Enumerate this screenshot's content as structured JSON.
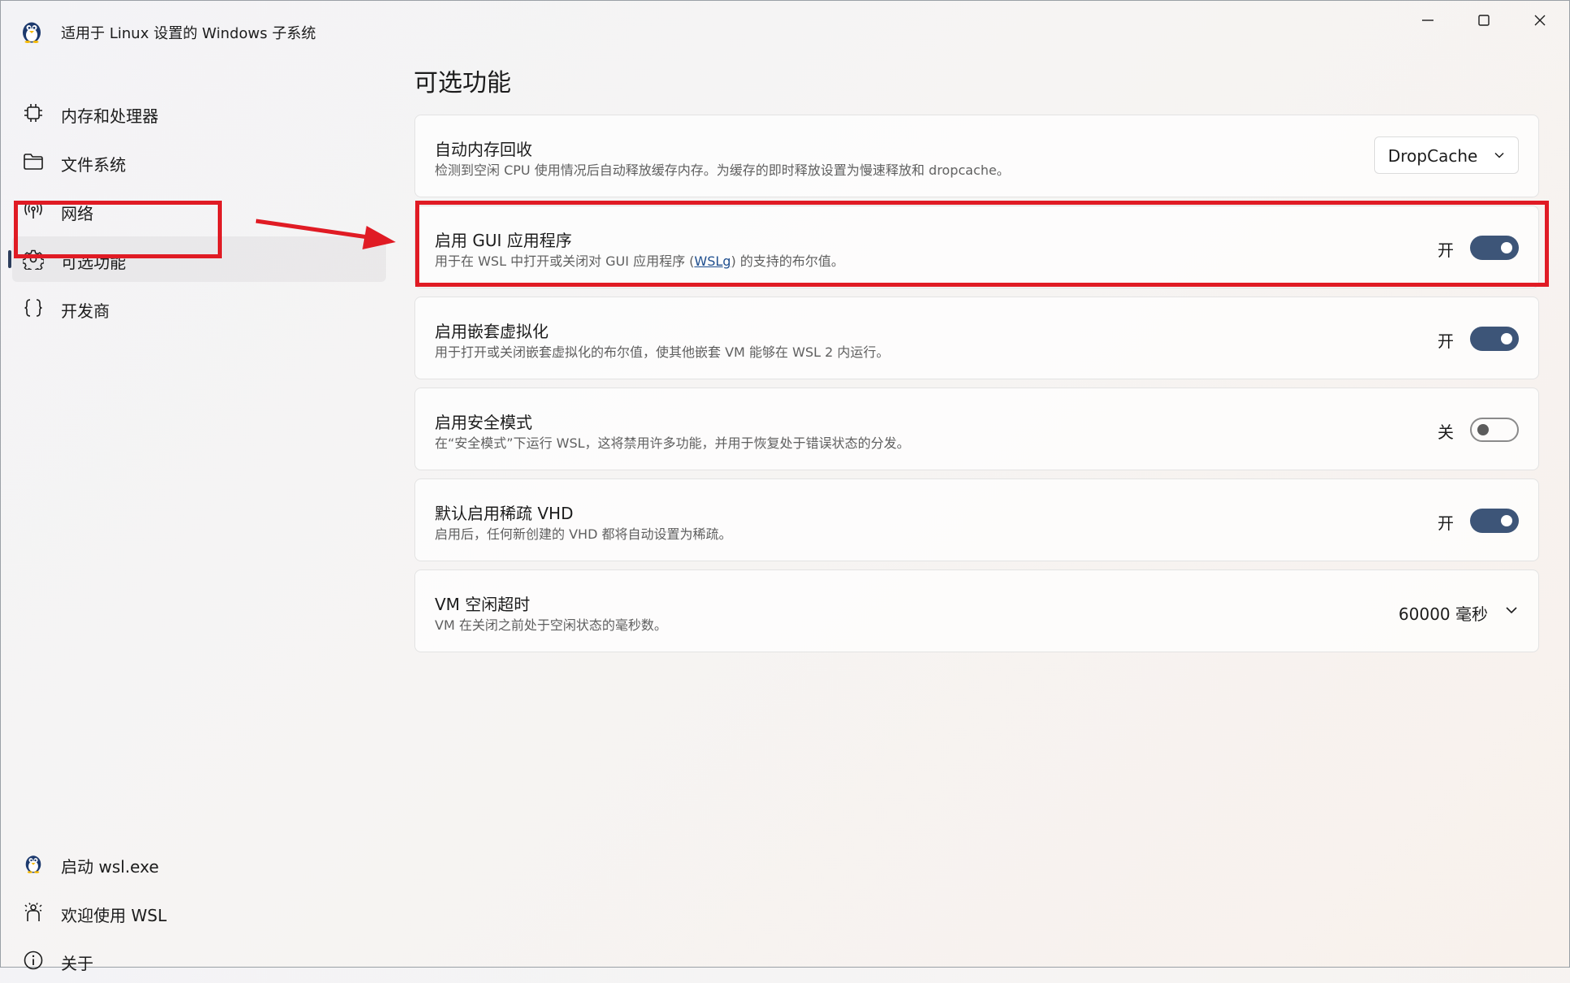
{
  "window": {
    "title": "适用于 Linux 设置的 Windows 子系统",
    "app_icon": "tux-penguin-icon",
    "caption_buttons": [
      "minimize-icon",
      "maximize-icon",
      "close-icon"
    ]
  },
  "sidebar": {
    "items": [
      {
        "label": "内存和处理器",
        "icon": "chip-icon"
      },
      {
        "label": "文件系统",
        "icon": "folder-icon"
      },
      {
        "label": "网络",
        "icon": "antenna-icon"
      },
      {
        "label": "可选功能",
        "icon": "gear-icon",
        "selected": true
      },
      {
        "label": "开发商",
        "icon": "braces-icon"
      }
    ],
    "bottom_items": [
      {
        "label": "启动 wsl.exe",
        "icon": "tux-penguin-icon"
      },
      {
        "label": "欢迎使用 WSL",
        "icon": "welcome-icon"
      },
      {
        "label": "关于",
        "icon": "info-icon"
      }
    ]
  },
  "main": {
    "title": "可选功能",
    "settings": [
      {
        "title": "自动内存回收",
        "description": "检测到空闲 CPU 使用情况后自动释放缓存内存。为缓存的即时释放设置为慢速释放和 dropcache。",
        "control": "dropdown",
        "value": "DropCache"
      },
      {
        "title": "启用 GUI 应用程序",
        "description_before": "用于在 WSL 中打开或关闭对 GUI 应用程序 (",
        "description_link": "WSLg",
        "description_after": ") 的支持的布尔值。",
        "control": "toggle",
        "state_label": "开",
        "on": true
      },
      {
        "title": "启用嵌套虚拟化",
        "description": "用于打开或关闭嵌套虚拟化的布尔值，使其他嵌套 VM 能够在 WSL 2 内运行。",
        "control": "toggle",
        "state_label": "开",
        "on": true
      },
      {
        "title": "启用安全模式",
        "description": "在“安全模式”下运行 WSL，这将禁用许多功能，并用于恢复处于错误状态的分发。",
        "control": "toggle",
        "state_label": "关",
        "on": false
      },
      {
        "title": "默认启用稀疏 VHD",
        "description": "启用后，任何新创建的 VHD 都将自动设置为稀疏。",
        "control": "toggle",
        "state_label": "开",
        "on": true
      },
      {
        "title": "VM 空闲超时",
        "description": "VM 在关闭之前处于空闲状态的毫秒数。",
        "control": "value",
        "value": "60000 毫秒"
      }
    ]
  },
  "colors": {
    "toggle_on": "#3d5578",
    "annotation_red": "#e01b24",
    "link": "#1f4f8f"
  }
}
